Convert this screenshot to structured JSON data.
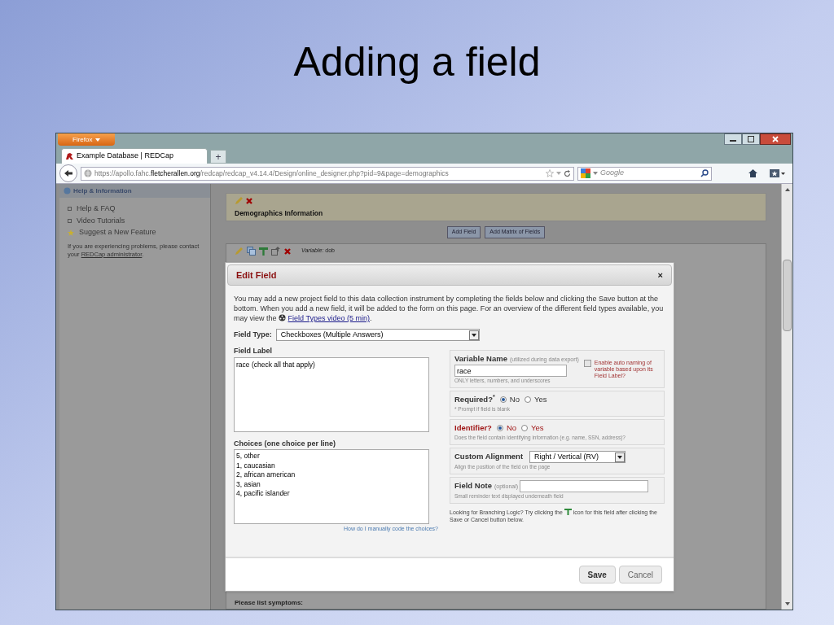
{
  "slide_title": "Adding a field",
  "browser": {
    "menu_button": "Firefox",
    "tabs": [
      {
        "label": "Example Database | REDCap",
        "selected": true
      }
    ],
    "new_tab_button": "+",
    "url": "https://apollo.fahc.**fletcherallen.org**/redcap/redcap_v4.14.4/Design/online_designer.php?pid=9&page=demographics",
    "search_placeholder": "Google"
  },
  "sidebar": {
    "heading": "Help & Information",
    "links": [
      {
        "label": "Help & FAQ",
        "kind": "bullet"
      },
      {
        "label": "Video Tutorials",
        "kind": "bullet"
      },
      {
        "label": "Suggest a New Feature",
        "kind": "star"
      }
    ],
    "note": "If you are experiencing problems, please contact your",
    "note_link": "REDCap administrator",
    "note_end": "."
  },
  "page": {
    "section_title": "Demographics Information",
    "buttons": [
      "Add Field",
      "Add Matrix of Fields"
    ],
    "field_variable": "*Variable:* dob",
    "bottom_label": "Please list symptoms:"
  },
  "dialog": {
    "title": "Edit Field",
    "close": "×",
    "intro": "You may add a new project field to this data collection instrument by completing the fields below and clicking the Save button at the bottom. When you add a new field, it will be added to the form on this page. For an overview of the different field types available, you may view the",
    "intro_link": "Field Types video (5 min)",
    "intro_end": ".",
    "field_type": {
      "label": "Field Type:",
      "value": "Checkboxes (Multiple Answers)"
    },
    "field_label": {
      "label": "Field Label",
      "value": "race (check all that apply)"
    },
    "choices": {
      "label": "Choices (one choice per line)",
      "value": "5, other\n1, caucasian\n2, african american\n3, asian\n4, pacific islander",
      "help_link": "How do I manually code the choices?"
    },
    "variable_name": {
      "label": "Variable Name",
      "hint": "(utilized during data export)",
      "value": "race",
      "note": "ONLY letters, numbers, and underscores",
      "auto_naming": {
        "label": "Enable auto naming of variable based upon its Field Label?",
        "checked": false
      }
    },
    "required": {
      "label": "Required?$^{*}$",
      "options": [
        {
          "label": "No",
          "selected": true
        },
        {
          "label": "Yes",
          "selected": false
        }
      ],
      "note": "* Prompt if field is blank"
    },
    "identifier": {
      "label": "Identifier?",
      "options": [
        {
          "label": "No",
          "selected": true
        },
        {
          "label": "Yes",
          "selected": false
        }
      ],
      "note": "Does the field contain identifying information (e.g. name, SSN, address)?"
    },
    "alignment": {
      "label": "Custom Alignment",
      "value": "Right / Vertical (RV)",
      "note": "Align the position of the field on the page"
    },
    "field_note": {
      "label": "Field Note",
      "hint": "(optional)",
      "note": "Small reminder text displayed underneath field"
    },
    "branching_tip": {
      "before": "Looking for Branching Logic? Try clicking the",
      "after": "icon for this field after clicking the Save or Cancel button below."
    },
    "buttons": [
      {
        "label": "Save",
        "kind": "primary"
      },
      {
        "label": "Cancel",
        "kind": "secondary"
      }
    ]
  }
}
